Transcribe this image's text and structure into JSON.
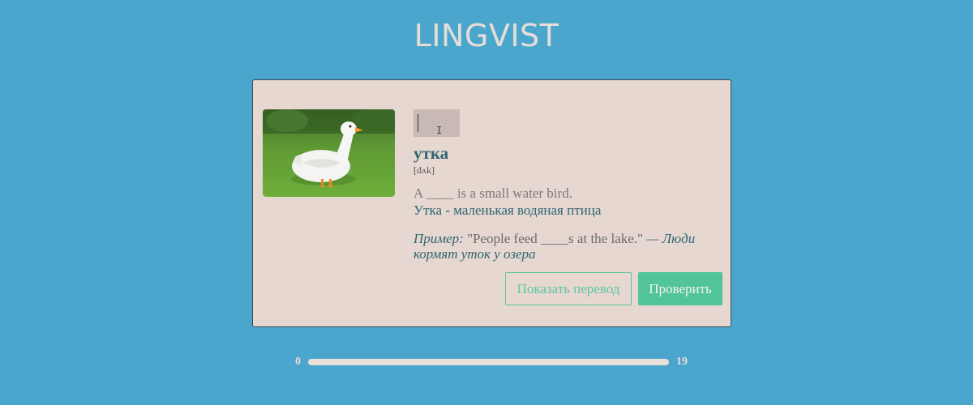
{
  "header": {
    "logo": "LINGVIST"
  },
  "card": {
    "image_icon": "duck-photo",
    "answer_input": {
      "value": "",
      "placeholder": ""
    },
    "word": "утка",
    "transcription": "[dʌk]",
    "definition": "A ____ is a small water bird.",
    "translation": "Утка - маленькая водяная птица",
    "example": {
      "label": "Пример:",
      "text": "\"People feed ____s at the lake.\"",
      "dash": " — ",
      "translation": "Люди кормят уток у озера"
    },
    "buttons": {
      "show_translation": "Показать перевод",
      "check": "Проверить"
    }
  },
  "progress": {
    "min": "0",
    "max": "19",
    "current": 0
  },
  "colors": {
    "background": "#4aa6cc",
    "card": "#e6d7d0",
    "accent": "#52c49a",
    "text_dark": "#2f6572"
  }
}
